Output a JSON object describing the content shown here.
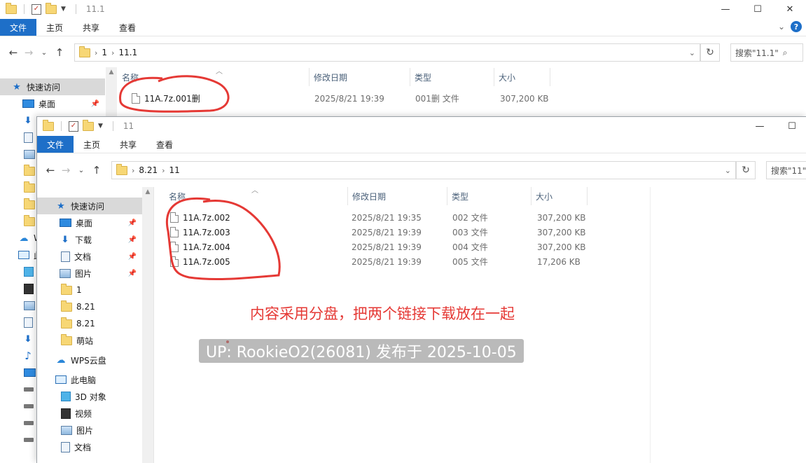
{
  "back_window": {
    "title": "11.1",
    "ribbon_tabs": [
      "文件",
      "主页",
      "共享",
      "查看"
    ],
    "path": [
      "1",
      "11.1"
    ],
    "search_placeholder": "搜索\"11.1\"",
    "columns": [
      "名称",
      "修改日期",
      "类型",
      "大小"
    ],
    "files": [
      {
        "name": "11A.7z.001删",
        "date": "2025/8/21 19:39",
        "type": "001删 文件",
        "size": "307,200 KB"
      }
    ],
    "sidebar": {
      "quick_access": "快速访问",
      "desktop": "桌面"
    }
  },
  "front_window": {
    "title": "11",
    "ribbon_tabs": [
      "文件",
      "主页",
      "共享",
      "查看"
    ],
    "path": [
      "8.21",
      "11"
    ],
    "search_placeholder": "搜索\"11\"",
    "columns": [
      "名称",
      "修改日期",
      "类型",
      "大小"
    ],
    "files": [
      {
        "name": "11A.7z.002",
        "date": "2025/8/21 19:35",
        "type": "002 文件",
        "size": "307,200 KB"
      },
      {
        "name": "11A.7z.003",
        "date": "2025/8/21 19:39",
        "type": "003 文件",
        "size": "307,200 KB"
      },
      {
        "name": "11A.7z.004",
        "date": "2025/8/21 19:39",
        "type": "004 文件",
        "size": "307,200 KB"
      },
      {
        "name": "11A.7z.005",
        "date": "2025/8/21 19:39",
        "type": "005 文件",
        "size": "17,206 KB"
      }
    ],
    "sidebar": {
      "quick_access": "快速访问",
      "desktop": "桌面",
      "downloads": "下载",
      "documents": "文档",
      "pictures": "图片",
      "folder_1": "1",
      "folder_821a": "8.21",
      "folder_821b": "8.21",
      "folder_mengzhan": "萌站",
      "wps_cloud": "WPS云盘",
      "this_pc": "此电脑",
      "objects_3d": "3D 对象",
      "videos": "视频",
      "pc_pictures": "图片",
      "pc_documents": "文档"
    }
  },
  "annotation": "内容采用分盘，把两个链接下载放在一起",
  "watermark": "UP: RookieO2(26081) 发布于 2025-10-05",
  "colors": {
    "file_tab": "#1e6fc8",
    "annotation_red": "#e53935",
    "selected_row": "#d9d9d9"
  }
}
